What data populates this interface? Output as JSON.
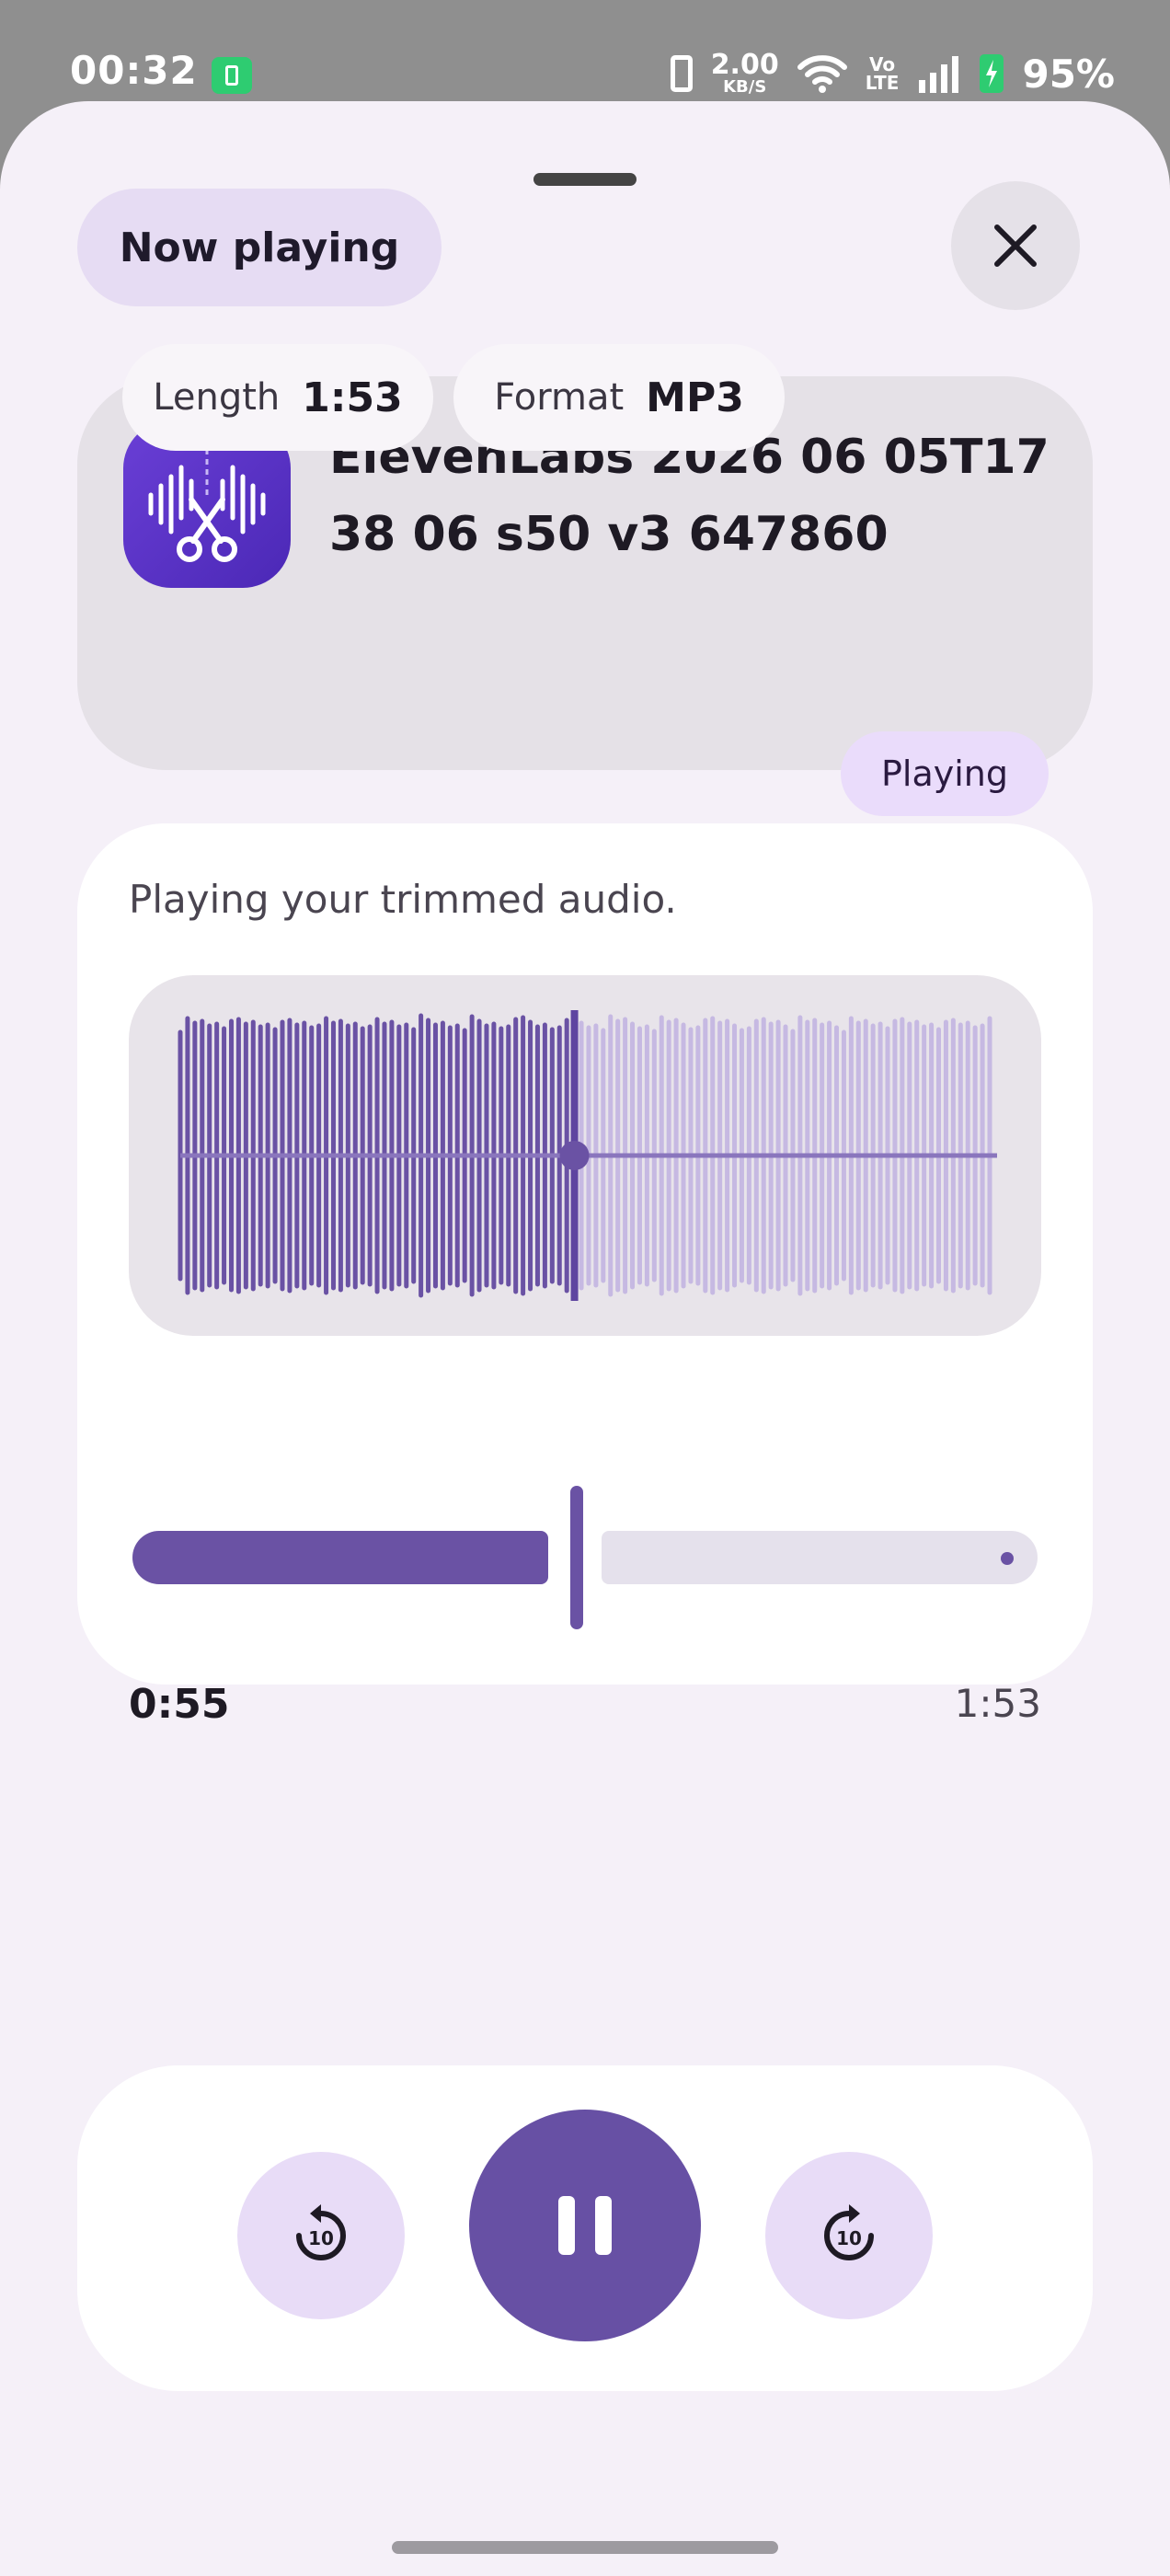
{
  "status_bar": {
    "time": "00:32",
    "net_speed_value": "2.00",
    "net_speed_unit": "KB/S",
    "volte_top": "Vo",
    "volte_bottom": "LTE",
    "battery_percent": "95%"
  },
  "header": {
    "chip_label": "Now playing",
    "close_icon": "close-icon"
  },
  "file_info": {
    "title": "ElevenLabs 2026 06 05T17 38 06 s50 v3 647860",
    "length_label": "Length",
    "length_value": "1:53",
    "format_label": "Format",
    "format_value": "MP3",
    "state_badge": "Playing",
    "app_icon": "waveform-scissors-icon"
  },
  "player": {
    "status_text": "Playing your trimmed audio.",
    "current_time": "0:55",
    "total_time": "1:53",
    "progress_fraction": 0.487
  },
  "controls": {
    "rewind_label": "10",
    "forward_label": "10",
    "rewind_icon": "replay-10-icon",
    "play_pause_icon": "pause-icon",
    "forward_icon": "forward-10-icon"
  },
  "colors": {
    "accent": "#6750a4",
    "sheet_bg": "#f5f0f8",
    "chip_bg": "#e6dcf3"
  }
}
